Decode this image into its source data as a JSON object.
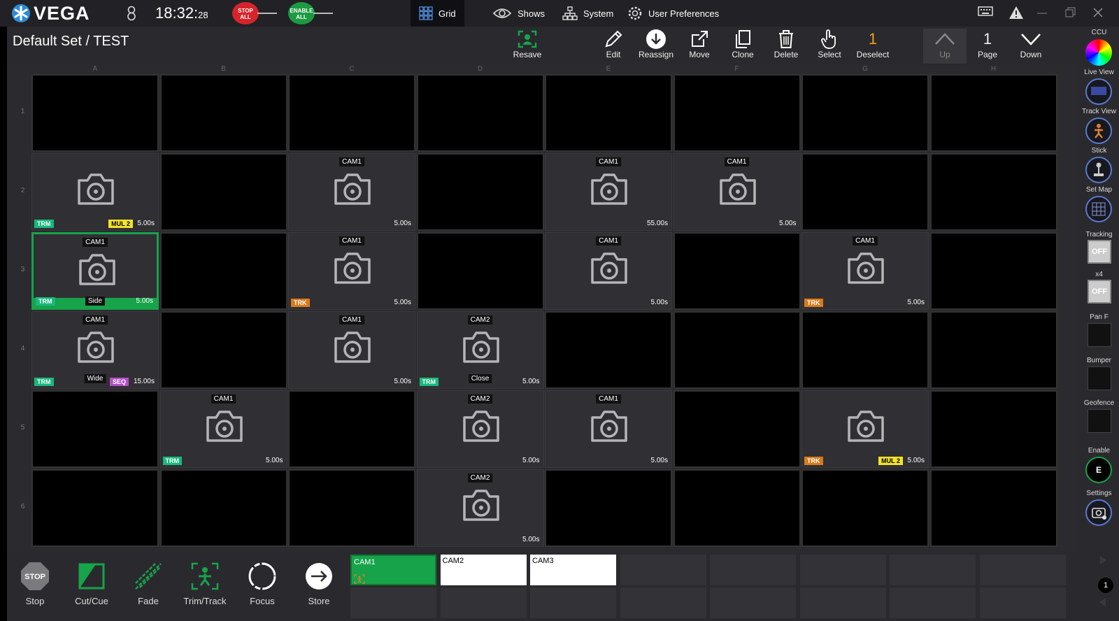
{
  "app": {
    "name": "VEGA",
    "user_count": "8",
    "time": "18:32:",
    "time_seconds": "28"
  },
  "top_buttons": {
    "stop_all": "STOP ALL",
    "enable_all": "ENABLE ALL"
  },
  "top_nav": [
    {
      "label": "Grid",
      "active": true
    },
    {
      "label": "Shows",
      "active": false
    },
    {
      "label": "System",
      "active": false
    },
    {
      "label": "User Preferences",
      "active": false
    }
  ],
  "toolbar": {
    "set_title": "Default Set / TEST",
    "resave": "Resave",
    "edit": "Edit",
    "reassign": "Reassign",
    "move": "Move",
    "clone": "Clone",
    "delete": "Delete",
    "select": "Select",
    "deselect_count": "1",
    "deselect": "Deselect",
    "up": "Up",
    "page_number": "1",
    "page": "Page",
    "down": "Down"
  },
  "grid": {
    "columns": [
      "A",
      "B",
      "C",
      "D",
      "E",
      "F",
      "G",
      "H"
    ],
    "rows": [
      "1",
      "2",
      "3",
      "4",
      "5",
      "6"
    ],
    "shots": [
      {
        "row": 2,
        "col": 1,
        "cam": "",
        "name": "",
        "duration": "5.00s",
        "badges": [
          {
            "type": "trm",
            "label": "TRM"
          },
          {
            "type": "mul",
            "label": "MUL 2"
          }
        ]
      },
      {
        "row": 2,
        "col": 3,
        "cam": "CAM1",
        "name": "",
        "duration": "5.00s",
        "badges": []
      },
      {
        "row": 2,
        "col": 5,
        "cam": "CAM1",
        "name": "",
        "duration": "55.00s",
        "badges": []
      },
      {
        "row": 2,
        "col": 6,
        "cam": "CAM1",
        "name": "",
        "duration": "5.00s",
        "badges": []
      },
      {
        "row": 3,
        "col": 1,
        "cam": "CAM1",
        "name": "Side",
        "duration": "5.00s",
        "badges": [
          {
            "type": "trm",
            "label": "TRM"
          }
        ],
        "selected": true
      },
      {
        "row": 3,
        "col": 3,
        "cam": "CAM1",
        "name": "",
        "duration": "5.00s",
        "badges": [
          {
            "type": "trk",
            "label": "TRK"
          }
        ]
      },
      {
        "row": 3,
        "col": 5,
        "cam": "CAM1",
        "name": "",
        "duration": "5.00s",
        "badges": []
      },
      {
        "row": 3,
        "col": 7,
        "cam": "CAM1",
        "name": "",
        "duration": "5.00s",
        "badges": [
          {
            "type": "trk",
            "label": "TRK"
          }
        ]
      },
      {
        "row": 4,
        "col": 1,
        "cam": "CAM1",
        "name": "Wide",
        "duration": "15.00s",
        "badges": [
          {
            "type": "trm",
            "label": "TRM"
          },
          {
            "type": "seq",
            "label": "SEQ"
          }
        ]
      },
      {
        "row": 4,
        "col": 3,
        "cam": "CAM1",
        "name": "",
        "duration": "5.00s",
        "badges": []
      },
      {
        "row": 4,
        "col": 4,
        "cam": "CAM2",
        "name": "Close",
        "duration": "5.00s",
        "badges": [
          {
            "type": "trm",
            "label": "TRM"
          }
        ]
      },
      {
        "row": 5,
        "col": 2,
        "cam": "CAM1",
        "name": "",
        "duration": "5.00s",
        "badges": [
          {
            "type": "trm",
            "label": "TRM"
          }
        ]
      },
      {
        "row": 5,
        "col": 4,
        "cam": "CAM2",
        "name": "",
        "duration": "5.00s",
        "badges": []
      },
      {
        "row": 5,
        "col": 5,
        "cam": "CAM1",
        "name": "",
        "duration": "5.00s",
        "badges": []
      },
      {
        "row": 5,
        "col": 7,
        "cam": "",
        "name": "",
        "duration": "5.00s",
        "badges": [
          {
            "type": "trk",
            "label": "TRK"
          },
          {
            "type": "mul",
            "label": "MUL 2"
          }
        ]
      },
      {
        "row": 6,
        "col": 4,
        "cam": "CAM2",
        "name": "",
        "duration": "5.00s",
        "badges": []
      }
    ]
  },
  "right_panel": {
    "ccu": "CCU",
    "live_view": "Live View",
    "track_view": "Track View",
    "stick": "Stick",
    "set_map": "Set Map",
    "tracking": "Tracking",
    "tracking_state": "OFF",
    "x4": "x4",
    "x4_state": "OFF",
    "pan_f": "Pan F",
    "bumper": "Bumper",
    "geofence": "Geofence",
    "enable": "Enable",
    "enable_letter": "E",
    "settings": "Settings"
  },
  "bottom": {
    "stop_icon": "STOP",
    "stop": "Stop",
    "cut_cue": "Cut/Cue",
    "fade": "Fade",
    "trim_track": "Trim/Track",
    "focus": "Focus",
    "store": "Store",
    "cameras": [
      "CAM1",
      "CAM2",
      "CAM3"
    ],
    "page": "1"
  },
  "colors": {
    "accent_green": "#17a34a",
    "trm": "#18b87c",
    "trk": "#d97a1a",
    "mul": "#f3e12a",
    "seq": "#b24fc7"
  }
}
